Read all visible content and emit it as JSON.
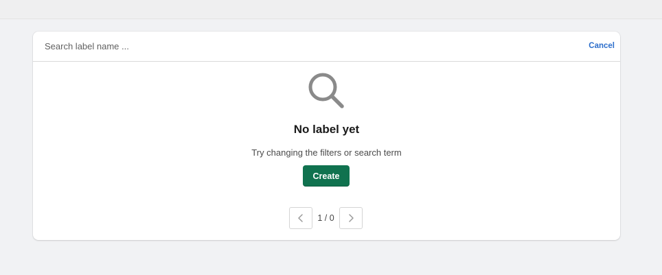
{
  "search": {
    "placeholder": "Search label name ...",
    "value": "",
    "cancel_label": "Cancel"
  },
  "empty_state": {
    "icon": "search-icon",
    "title": "No label yet",
    "description": "Try changing the filters or search term",
    "create_label": "Create"
  },
  "pagination": {
    "label": "1 / 0",
    "prev_icon": "chevron-left-icon",
    "next_icon": "chevron-right-icon"
  },
  "colors": {
    "primary": "#10724f",
    "link": "#2c6ecb",
    "background": "#f1f2f4"
  }
}
